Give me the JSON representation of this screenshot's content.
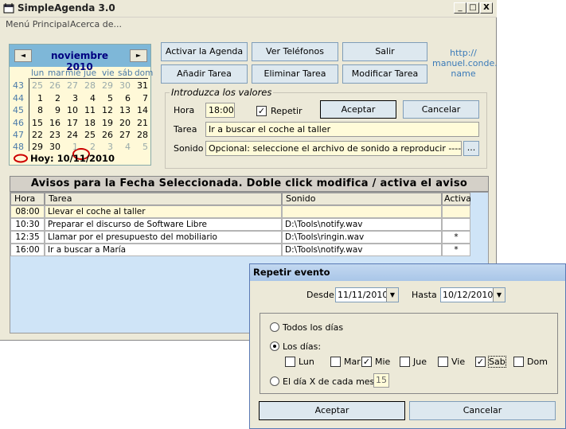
{
  "app": {
    "title": "SimpleAgenda 3.0",
    "min": "_",
    "max": "□",
    "close": "X"
  },
  "menu": [
    "Menú Principal",
    "Acerca de..."
  ],
  "toolbar": {
    "activar": "Activar la Agenda",
    "telefonos": "Ver Teléfonos",
    "salir": "Salir",
    "anadir": "Añadir Tarea",
    "eliminar": "Eliminar Tarea",
    "modificar": "Modificar Tarea"
  },
  "url": [
    "http://",
    "manuel.conde.",
    "name"
  ],
  "calendar": {
    "month": "noviembre 2010",
    "prev": "◄",
    "next": "►",
    "dow": [
      "lun",
      "mar",
      "mié",
      "jue",
      "vie",
      "sáb",
      "dom"
    ],
    "weeks": [
      "43",
      "44",
      "45",
      "46",
      "47",
      "48"
    ],
    "days": [
      [
        "25",
        "26",
        "27",
        "28",
        "29",
        "30",
        "31"
      ],
      [
        "1",
        "2",
        "3",
        "4",
        "5",
        "6",
        "7"
      ],
      [
        "8",
        "9",
        "10",
        "11",
        "12",
        "13",
        "14"
      ],
      [
        "15",
        "16",
        "17",
        "18",
        "19",
        "20",
        "21"
      ],
      [
        "22",
        "23",
        "24",
        "25",
        "26",
        "27",
        "28"
      ],
      [
        "29",
        "30",
        "1",
        "2",
        "3",
        "4",
        "5"
      ]
    ],
    "today": "Hoy: 10/11/2010"
  },
  "form": {
    "group_title": "Introduzca los valores",
    "hora_label": "Hora",
    "hora_value": "18:00",
    "repetir_label": "Repetir",
    "aceptar": "Aceptar",
    "cancelar": "Cancelar",
    "tarea_label": "Tarea",
    "tarea_value": "Ir a buscar el coche al taller",
    "sonido_label": "Sonido",
    "sonido_value": "Opcional: seleccione el archivo de sonido a reproducir   ------------->",
    "browse": "..."
  },
  "avisos": {
    "title": "Avisos para la Fecha Seleccionada. Doble click modifica / activa el aviso",
    "headers": [
      "Hora",
      "Tarea",
      "Sonido",
      "Activa"
    ],
    "rows": [
      [
        "08:00",
        "Llevar el coche al taller",
        "",
        ""
      ],
      [
        "10:30",
        "Preparar el discurso de Software Libre",
        "D:\\Tools\\notify.wav",
        ""
      ],
      [
        "12:35",
        "Llamar por el presupuesto del mobiliario",
        "D:\\Tools\\ringin.wav",
        "*"
      ],
      [
        "16:00",
        "Ir a buscar a María",
        "D:\\Tools\\notify.wav",
        "*"
      ]
    ]
  },
  "dialog": {
    "title": "Repetir evento",
    "desde_label": "Desde",
    "desde_value": "11/11/2010",
    "hasta_label": "Hasta",
    "hasta_value": "10/12/2010",
    "opt_todos": "Todos los días",
    "opt_dias": "Los días:",
    "days": [
      "Lun",
      "Mar",
      "Mie",
      "Jue",
      "Vie",
      "Sab",
      "Dom"
    ],
    "days_checked": [
      false,
      false,
      true,
      false,
      false,
      true,
      false
    ],
    "opt_diax": "El día X de cada mes",
    "diax_value": "15",
    "aceptar": "Aceptar",
    "cancelar": "Cancelar"
  }
}
